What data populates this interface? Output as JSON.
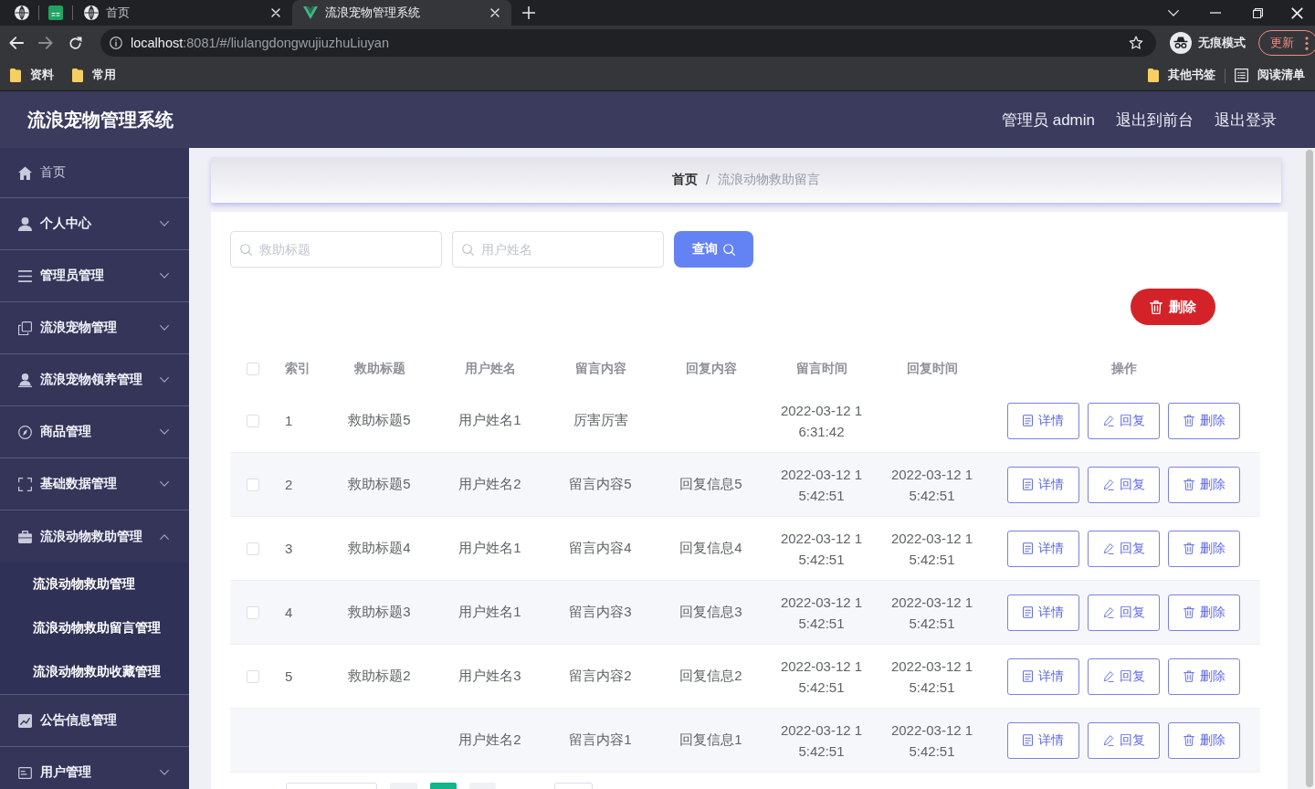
{
  "browser": {
    "tabs": [
      {
        "kind": "pinned",
        "selected": false
      },
      {
        "kind": "pinned",
        "selected": false
      },
      {
        "kind": "page",
        "title": "首页",
        "selected": false
      },
      {
        "kind": "page",
        "title": "流浪宠物管理系统",
        "selected": true
      }
    ],
    "address": {
      "host": "localhost",
      "path": ":8081/#/liulangdongwujiuzhuLiuyan"
    },
    "profile": "无痕模式",
    "update_button": "更新",
    "bookmarks": [
      {
        "kind": "folder",
        "label": "资料"
      },
      {
        "kind": "folder",
        "label": "常用"
      }
    ],
    "bookmarks_right": [
      {
        "kind": "folder",
        "label": "其他书签"
      },
      {
        "kind": "reading_list",
        "label": "阅读清单"
      }
    ]
  },
  "header": {
    "title": "流浪宠物管理系统",
    "links": [
      "管理员 admin",
      "退出到前台",
      "退出登录"
    ]
  },
  "sidebar": {
    "items": [
      {
        "kind": "link",
        "label": "首页"
      },
      {
        "kind": "menu",
        "label": "个人中心",
        "expanded": false
      },
      {
        "kind": "menu",
        "label": "管理员管理",
        "expanded": false
      },
      {
        "kind": "menu",
        "label": "流浪宠物管理",
        "expanded": false
      },
      {
        "kind": "menu",
        "label": "流浪宠物领养管理",
        "expanded": false
      },
      {
        "kind": "menu",
        "label": "商品管理",
        "expanded": false
      },
      {
        "kind": "menu",
        "label": "基础数据管理",
        "expanded": false
      },
      {
        "kind": "menu",
        "label": "流浪动物救助管理",
        "expanded": true,
        "children": [
          {
            "label": "流浪动物救助管理"
          },
          {
            "label": "流浪动物救助留言管理"
          },
          {
            "label": "流浪动物救助收藏管理"
          }
        ]
      },
      {
        "kind": "menu",
        "label": "公告信息管理"
      },
      {
        "kind": "menu",
        "label": "用户管理",
        "expanded": false
      }
    ]
  },
  "breadcrumb": {
    "items": [
      "首页",
      "流浪动物救助留言"
    ],
    "separator": "/"
  },
  "search": {
    "fields": [
      {
        "placeholder": "救助标题"
      },
      {
        "placeholder": "用户姓名"
      }
    ],
    "button": "查询"
  },
  "bulk_delete_button": "删除",
  "table": {
    "columns": [
      "索引",
      "救助标题",
      "用户姓名",
      "留言内容",
      "回复内容",
      "留言时间",
      "回复时间",
      "操作"
    ],
    "all_checked": false,
    "rows": [
      {
        "checked": false,
        "index": "1",
        "title": "救助标题5",
        "user": "用户姓名1",
        "message": "厉害厉害",
        "message_time": "2022-03-12 16:31:42",
        "actions": [
          "详情",
          "回复",
          "删除"
        ]
      },
      {
        "checked": false,
        "index": "2",
        "title": "救助标题5",
        "user": "用户姓名2",
        "message": "留言内容5",
        "reply": "回复信息5",
        "message_time": "2022-03-12 15:42:51",
        "reply_time": "2022-03-12 15:42:51",
        "actions": [
          "详情",
          "回复",
          "删除"
        ]
      },
      {
        "checked": false,
        "index": "3",
        "title": "救助标题4",
        "user": "用户姓名1",
        "message": "留言内容4",
        "reply": "回复信息4",
        "message_time": "2022-03-12 15:42:51",
        "reply_time": "2022-03-12 15:42:51",
        "actions": [
          "详情",
          "回复",
          "删除"
        ]
      },
      {
        "checked": false,
        "index": "4",
        "title": "救助标题3",
        "user": "用户姓名1",
        "message": "留言内容3",
        "reply": "回复信息3",
        "message_time": "2022-03-12 15:42:51",
        "reply_time": "2022-03-12 15:42:51",
        "actions": [
          "详情",
          "回复",
          "删除"
        ]
      },
      {
        "checked": false,
        "index": "5",
        "title": "救助标题2",
        "user": "用户姓名3",
        "message": "留言内容2",
        "reply": "回复信息2",
        "message_time": "2022-03-12 15:42:51",
        "reply_time": "2022-03-12 15:42:51",
        "actions": [
          "详情",
          "回复",
          "删除"
        ]
      },
      {
        "user": "用户姓名2",
        "message": "留言内容1",
        "reply": "回复信息1",
        "message_time": "2022-03-12 15:42:51",
        "reply_time": "2022-03-12 15:42:51",
        "actions": [
          "详情",
          "回复",
          "删除"
        ]
      }
    ]
  },
  "pagination": {
    "items": [
      {
        "kind": "field"
      },
      {
        "kind": "button"
      },
      {
        "kind": "page",
        "selected": true
      },
      {
        "kind": "page",
        "selected": false
      },
      {
        "kind": "field"
      }
    ]
  }
}
